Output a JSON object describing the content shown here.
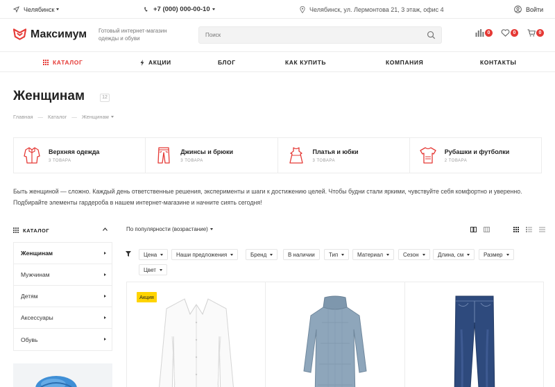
{
  "topbar": {
    "city": "Челябинск",
    "phone": "+7 (000) 000-00-10",
    "address": "Челябинск, ул. Лермонтова 21, 3 этаж, офис 4",
    "login": "Войти"
  },
  "header": {
    "logo": "Максимум",
    "slogan": "Готовый интернет-магазин одежды и обуви",
    "search_placeholder": "Поиск",
    "compare_count": "0",
    "favorites_count": "0",
    "cart_count": "0"
  },
  "nav": [
    {
      "label": "КАТАЛОГ",
      "active": true
    },
    {
      "label": "АКЦИИ"
    },
    {
      "label": "БЛОГ"
    },
    {
      "label": "КАК КУПИТЬ"
    },
    {
      "label": "КОМПАНИЯ"
    },
    {
      "label": "КОНТАКТЫ"
    }
  ],
  "page": {
    "title": "Женщинам",
    "count": "12",
    "breadcrumb": [
      "Главная",
      "Каталог",
      "Женщинам"
    ]
  },
  "categories": [
    {
      "name": "Верхняя одежда",
      "count": "3 ТОВАРА",
      "icon": "jacket-icon"
    },
    {
      "name": "Джинсы и брюки",
      "count": "3 ТОВАРА",
      "icon": "jeans-icon"
    },
    {
      "name": "Платья и юбки",
      "count": "3 ТОВАРА",
      "icon": "dress-icon"
    },
    {
      "name": "Рубашки и футболки",
      "count": "2 ТОВАРА",
      "icon": "tshirt-icon"
    }
  ],
  "description": "Быть женщиной — сложно. Каждый день ответственные решения, эксперименты и шаги к достижению целей. Чтобы будни стали яркими, чувствуйте себя комфортно и уверенно. Подбирайте элементы гардероба в нашем интернет-магазине и начните сиять сегодня!",
  "sidebar": {
    "title": "КАТАЛОГ",
    "items": [
      {
        "label": "Женщинам",
        "active": true
      },
      {
        "label": "Мужчинам"
      },
      {
        "label": "Детям"
      },
      {
        "label": "Аксессуары"
      },
      {
        "label": "Обувь"
      }
    ]
  },
  "sort": {
    "label": "По популярности (возрастание)"
  },
  "filters": [
    "Цена",
    "Наши предложения",
    "Бренд",
    "В наличии",
    "Тип",
    "Материал",
    "Сезон",
    "Длина, см",
    "Размер",
    "Цвет"
  ],
  "products": [
    {
      "badge": "Акция",
      "image": "white-shirt"
    },
    {
      "badge": "",
      "image": "blue-knit-dress"
    },
    {
      "badge": "",
      "image": "blue-jeans"
    }
  ],
  "colors": {
    "accent": "#e53935",
    "sale_badge": "#ffd400"
  }
}
